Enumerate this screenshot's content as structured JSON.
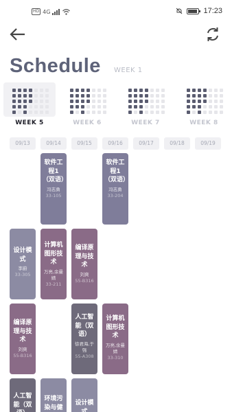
{
  "status_bar": {
    "network_label": "HD",
    "signal_label": "4G",
    "time": "17:23"
  },
  "header": {
    "title": "Schedule",
    "subtitle": "WEEK 1",
    "back_icon": "arrow-left-icon",
    "refresh_icon": "refresh-icon"
  },
  "weeks": [
    {
      "label": "WEEK 5",
      "active": true
    },
    {
      "label": "WEEK 6",
      "active": false
    },
    {
      "label": "WEEK 7",
      "active": false
    },
    {
      "label": "WEEK 8",
      "active": false
    }
  ],
  "dates": [
    "09/13",
    "09/14",
    "09/15",
    "09/16",
    "09/17",
    "09/18",
    "09/19"
  ],
  "courses": {
    "c1": {
      "name": "软件工程1（双语）",
      "teacher": "冯志勇",
      "room": "33-105"
    },
    "c2": {
      "name": "软件工程1（双语）",
      "teacher": "冯志勇",
      "room": "33-204"
    },
    "c3": {
      "name": "设计模式",
      "teacher": "李蔚",
      "room": "33-305"
    },
    "c4": {
      "name": "计算机图形技术",
      "teacher": "万亮,余曼婧",
      "room": "33-211"
    },
    "c5": {
      "name": "编译原理与技术",
      "teacher": "刘爽",
      "room": "55-B316"
    },
    "c6": {
      "name": "编译原理与技术",
      "teacher": "刘爽",
      "room": "55-B316"
    },
    "c7": {
      "name": "人工智能（双语）",
      "teacher": "徐君海,于强",
      "room": "55-A308"
    },
    "c8": {
      "name": "计算机图形技术",
      "teacher": "万亮,余曼婧",
      "room": "33-310"
    },
    "c9": {
      "name": "人工智能（双语）",
      "teacher": "",
      "room": ""
    },
    "c10": {
      "name": "环境污染与健康",
      "teacher": "",
      "room": ""
    },
    "c11": {
      "name": "设计模式",
      "teacher": "",
      "room": ""
    }
  },
  "colors": {
    "slate": "#7f7d9a",
    "gray": "#8c8ba3",
    "plum": "#8a6b87",
    "dark": "#6e6a7a",
    "title": "#5e6379"
  }
}
